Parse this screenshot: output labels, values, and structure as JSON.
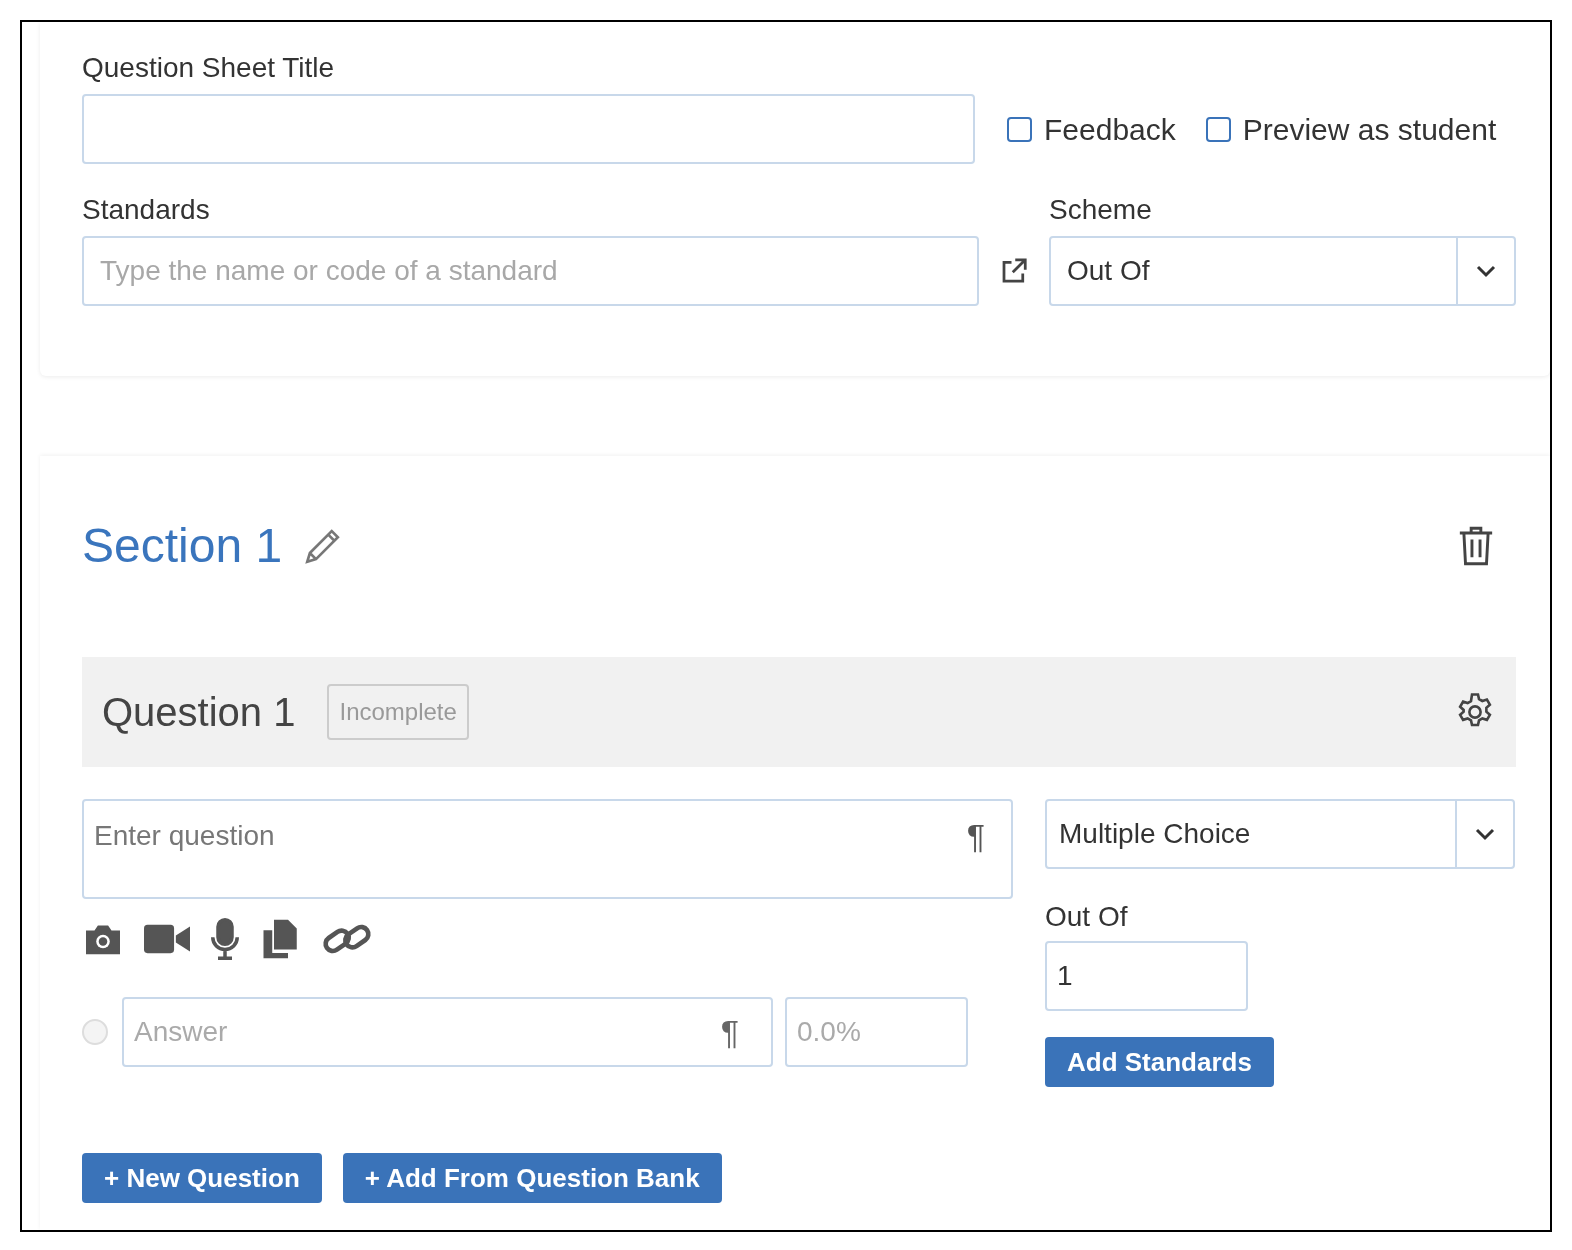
{
  "sheet": {
    "title_label": "Question Sheet Title",
    "options": [
      {
        "label": "Feedback",
        "checked": false
      },
      {
        "label": "Preview as student",
        "checked": false
      }
    ],
    "standards_label": "Standards",
    "standards_placeholder": "Type the name or code of a standard",
    "scheme_label": "Scheme",
    "scheme_value": "Out Of"
  },
  "section": {
    "title": "Section 1",
    "question": {
      "title": "Question 1",
      "status": "Incomplete",
      "placeholder": "Enter question",
      "format_mark": "¶",
      "type_value": "Multiple Choice",
      "out_of_label": "Out Of",
      "out_of_value": "1",
      "add_standards": "Add Standards",
      "answers": [
        {
          "placeholder": "Answer",
          "format_mark": "¶",
          "percent_placeholder": "0.0%",
          "selected": false
        }
      ]
    },
    "buttons": [
      "+ New Question",
      "+ Add From Question Bank"
    ]
  }
}
